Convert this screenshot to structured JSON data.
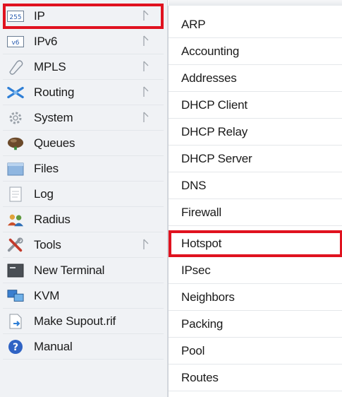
{
  "sidebar": {
    "items": [
      {
        "label": "IP",
        "icon": "ip-icon",
        "has_submenu": true,
        "selected": true
      },
      {
        "label": "IPv6",
        "icon": "ipv6-icon",
        "has_submenu": true
      },
      {
        "label": "MPLS",
        "icon": "mpls-icon",
        "has_submenu": true
      },
      {
        "label": "Routing",
        "icon": "routing-icon",
        "has_submenu": true
      },
      {
        "label": "System",
        "icon": "system-gear-icon",
        "has_submenu": true
      },
      {
        "label": "Queues",
        "icon": "queues-icon",
        "has_submenu": false
      },
      {
        "label": "Files",
        "icon": "folder-icon",
        "has_submenu": false
      },
      {
        "label": "Log",
        "icon": "log-document-icon",
        "has_submenu": false
      },
      {
        "label": "Radius",
        "icon": "radius-users-icon",
        "has_submenu": false
      },
      {
        "label": "Tools",
        "icon": "tools-icon",
        "has_submenu": true
      },
      {
        "label": "New Terminal",
        "icon": "terminal-icon",
        "has_submenu": false
      },
      {
        "label": "KVM",
        "icon": "kvm-icon",
        "has_submenu": false
      },
      {
        "label": "Make Supout.rif",
        "icon": "supout-file-icon",
        "has_submenu": false
      },
      {
        "label": "Manual",
        "icon": "help-icon",
        "has_submenu": false
      }
    ]
  },
  "submenu": {
    "items": [
      {
        "label": "ARP"
      },
      {
        "label": "Accounting"
      },
      {
        "label": "Addresses"
      },
      {
        "label": "DHCP Client"
      },
      {
        "label": "DHCP Relay"
      },
      {
        "label": "DHCP Server"
      },
      {
        "label": "DNS"
      },
      {
        "label": "Firewall"
      },
      {
        "label": "Hotspot",
        "selected": true
      },
      {
        "label": "IPsec"
      },
      {
        "label": "Neighbors"
      },
      {
        "label": "Packing"
      },
      {
        "label": "Pool"
      },
      {
        "label": "Routes"
      }
    ]
  },
  "colors": {
    "highlight": "#e0121f",
    "sidebar_bg": "#f0f2f5"
  }
}
